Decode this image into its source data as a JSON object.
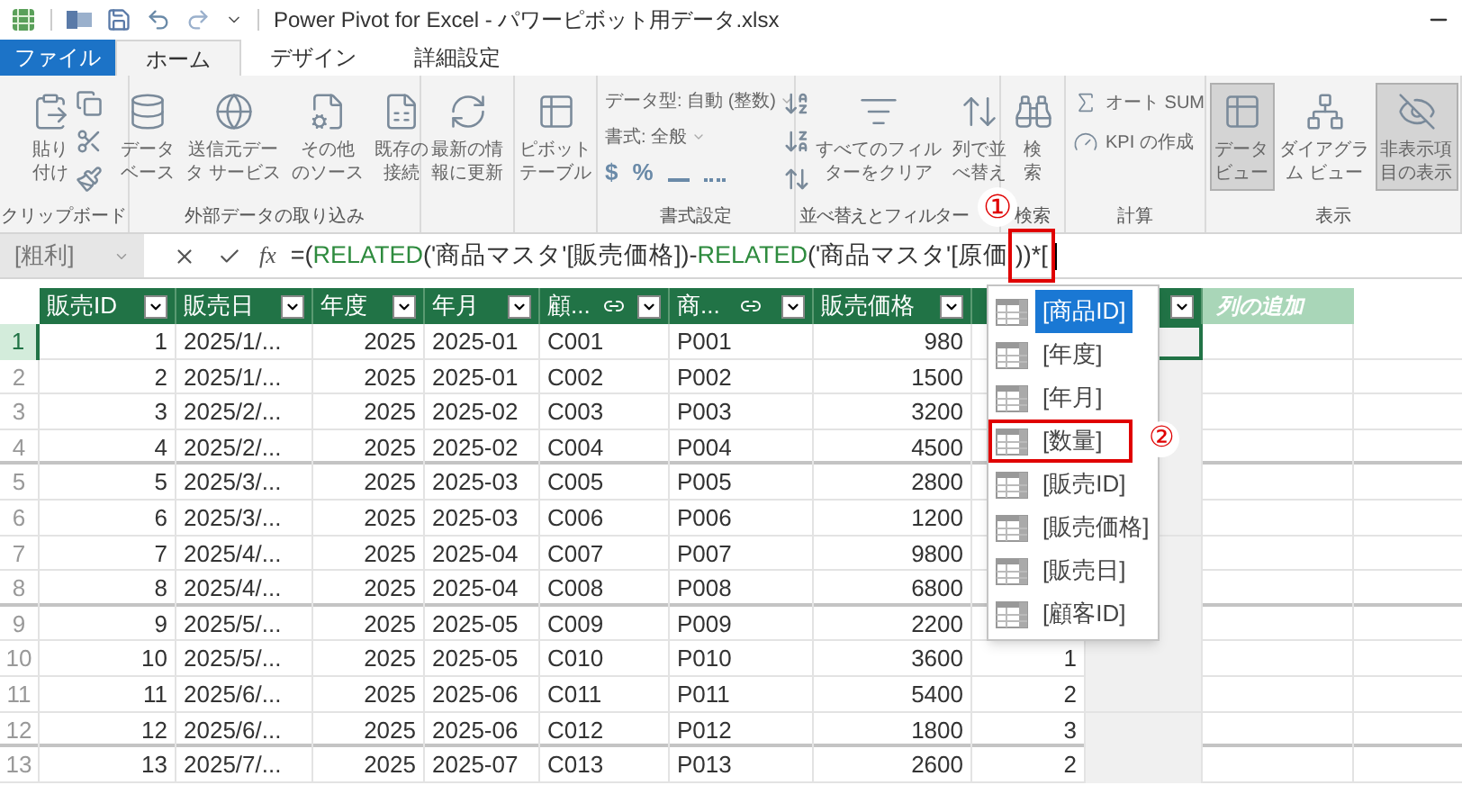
{
  "window": {
    "title": "Power Pivot for Excel - パワーピボット用データ.xlsx"
  },
  "tabs": [
    {
      "label": "ファイル",
      "kind": "file",
      "selected": false
    },
    {
      "label": "ホーム",
      "kind": "tab",
      "selected": true
    },
    {
      "label": "デザイン",
      "kind": "tab",
      "selected": false
    },
    {
      "label": "詳細設定",
      "kind": "tab",
      "selected": false
    }
  ],
  "ribbon": {
    "groups": [
      {
        "label": "クリップボード",
        "items": [
          {
            "kind": "large",
            "lines": [
              "貼り",
              "付け"
            ],
            "selected": false
          },
          {
            "kind": "small-icons"
          }
        ]
      },
      {
        "label": "外部データの取り込み",
        "items": [
          {
            "kind": "large",
            "lines": [
              "データ",
              "ベース"
            ],
            "selected": false
          },
          {
            "kind": "large",
            "lines": [
              "送信元デー",
              "タ サービス"
            ],
            "selected": false
          },
          {
            "kind": "large",
            "lines": [
              "その他",
              "のソース"
            ],
            "selected": false
          },
          {
            "kind": "large",
            "lines": [
              "既存の",
              "接続"
            ],
            "selected": false
          }
        ]
      },
      {
        "items": [
          {
            "kind": "large",
            "lines": [
              "最新の情",
              "報に更新"
            ],
            "selected": false
          }
        ]
      },
      {
        "items": [
          {
            "kind": "large",
            "lines": [
              "ピボット",
              "テーブル"
            ],
            "selected": false
          }
        ]
      },
      {
        "label": "書式設定",
        "items": [
          {
            "kind": "text-row",
            "text": "データ型: 自動 (整数)"
          },
          {
            "kind": "text-row",
            "text": "書式: 全般"
          },
          {
            "kind": "symbols",
            "symbols": [
              "$",
              "%"
            ]
          }
        ]
      },
      {
        "label": "並べ替えとフィルター",
        "items": [
          {
            "kind": "sort-icons"
          },
          {
            "kind": "large",
            "lines": [
              "すべてのフィル",
              "ターをクリア"
            ],
            "selected": false
          },
          {
            "kind": "large",
            "lines": [
              "列で並",
              "べ替え"
            ],
            "selected": false
          }
        ]
      },
      {
        "label": "検索",
        "items": [
          {
            "kind": "large",
            "lines": [
              "検",
              "索"
            ],
            "selected": false
          }
        ]
      },
      {
        "label": "計算",
        "items": [
          {
            "kind": "small",
            "text": "オート SUM"
          },
          {
            "kind": "small",
            "text": "KPI の作成"
          }
        ]
      },
      {
        "label": "表示",
        "items": [
          {
            "kind": "large",
            "lines": [
              "データ",
              "ビュー"
            ],
            "selected": true
          },
          {
            "kind": "large",
            "lines": [
              "ダイアグラ",
              "ム ビュー"
            ],
            "selected": false
          },
          {
            "kind": "large",
            "lines": [
              "非表示項",
              "目の表示"
            ],
            "selected": true
          }
        ]
      }
    ]
  },
  "formula_bar": {
    "name_box": "[粗利]",
    "fx": "fx",
    "formula": [
      {
        "kind": "plain",
        "text": "=("
      },
      {
        "kind": "function",
        "text": "RELATED"
      },
      {
        "kind": "plain",
        "text": "('商品マスタ'[販売価格])-"
      },
      {
        "kind": "function",
        "text": "RELATED"
      },
      {
        "kind": "plain",
        "text": "('商品マスタ'[原価"
      },
      {
        "kind": "boxed",
        "text": "))*["
      }
    ]
  },
  "grid": {
    "columns": [
      {
        "kind": "data",
        "label": "販売ID",
        "numeric": true,
        "relation": false
      },
      {
        "kind": "data",
        "label": "販売日",
        "numeric": false,
        "relation": false
      },
      {
        "kind": "data",
        "label": "年度",
        "numeric": true,
        "relation": false
      },
      {
        "kind": "data",
        "label": "年月",
        "numeric": false,
        "relation": false
      },
      {
        "kind": "data",
        "label": "顧...",
        "numeric": false,
        "relation": true
      },
      {
        "kind": "data",
        "label": "商...",
        "numeric": false,
        "relation": true
      },
      {
        "kind": "data",
        "label": "販売価格",
        "numeric": true,
        "relation": false
      },
      {
        "kind": "covered",
        "calculated": false
      },
      {
        "kind": "covered",
        "calculated": true
      },
      {
        "kind": "add",
        "label": "列の追加"
      }
    ],
    "rows": [
      {
        "number": "1",
        "selected": true,
        "group_end": false,
        "cells": [
          "1",
          "2025/1/...",
          "2025",
          "2025-01",
          "C001",
          "P001",
          "980"
        ]
      },
      {
        "number": "2",
        "selected": false,
        "group_end": false,
        "cells": [
          "2",
          "2025/1/...",
          "2025",
          "2025-01",
          "C002",
          "P002",
          "1500"
        ]
      },
      {
        "number": "3",
        "selected": false,
        "group_end": false,
        "cells": [
          "3",
          "2025/2/...",
          "2025",
          "2025-02",
          "C003",
          "P003",
          "3200"
        ]
      },
      {
        "number": "4",
        "selected": false,
        "group_end": true,
        "cells": [
          "4",
          "2025/2/...",
          "2025",
          "2025-02",
          "C004",
          "P004",
          "4500"
        ]
      },
      {
        "number": "5",
        "selected": false,
        "group_end": false,
        "cells": [
          "5",
          "2025/3/...",
          "2025",
          "2025-03",
          "C005",
          "P005",
          "2800"
        ]
      },
      {
        "number": "6",
        "selected": false,
        "group_end": false,
        "cells": [
          "6",
          "2025/3/...",
          "2025",
          "2025-03",
          "C006",
          "P006",
          "1200"
        ]
      },
      {
        "number": "7",
        "selected": false,
        "group_end": false,
        "cells": [
          "7",
          "2025/4/...",
          "2025",
          "2025-04",
          "C007",
          "P007",
          "9800"
        ]
      },
      {
        "number": "8",
        "selected": false,
        "group_end": true,
        "cells": [
          "8",
          "2025/4/...",
          "2025",
          "2025-04",
          "C008",
          "P008",
          "6800"
        ]
      },
      {
        "number": "9",
        "selected": false,
        "group_end": false,
        "cells": [
          "9",
          "2025/5/...",
          "2025",
          "2025-05",
          "C009",
          "P009",
          "2200"
        ]
      },
      {
        "number": "10",
        "selected": false,
        "group_end": false,
        "cells": [
          "10",
          "2025/5/...",
          "2025",
          "2025-05",
          "C010",
          "P010",
          "3600"
        ],
        "quantity": "1"
      },
      {
        "number": "11",
        "selected": false,
        "group_end": false,
        "cells": [
          "11",
          "2025/6/...",
          "2025",
          "2025-06",
          "C011",
          "P011",
          "5400"
        ],
        "quantity": "2"
      },
      {
        "number": "12",
        "selected": false,
        "group_end": true,
        "cells": [
          "12",
          "2025/6/...",
          "2025",
          "2025-06",
          "C012",
          "P012",
          "1800"
        ],
        "quantity": "3"
      },
      {
        "number": "13",
        "selected": false,
        "group_end": false,
        "cells": [
          "13",
          "2025/7/...",
          "2025",
          "2025-07",
          "C013",
          "P013",
          "2600"
        ],
        "quantity": "2"
      }
    ]
  },
  "autocomplete": {
    "items": [
      {
        "text": "[商品ID]",
        "selected": true,
        "boxed": false
      },
      {
        "text": "[年度]",
        "selected": false,
        "boxed": false
      },
      {
        "text": "[年月]",
        "selected": false,
        "boxed": false
      },
      {
        "text": "[数量]",
        "selected": false,
        "boxed": true
      },
      {
        "text": "[販売ID]",
        "selected": false,
        "boxed": false
      },
      {
        "text": "[販売価格]",
        "selected": false,
        "boxed": false
      },
      {
        "text": "[販売日]",
        "selected": false,
        "boxed": false
      },
      {
        "text": "[顧客ID]",
        "selected": false,
        "boxed": false
      }
    ]
  },
  "annotations": [
    {
      "text": "①"
    },
    {
      "text": "②"
    }
  ]
}
